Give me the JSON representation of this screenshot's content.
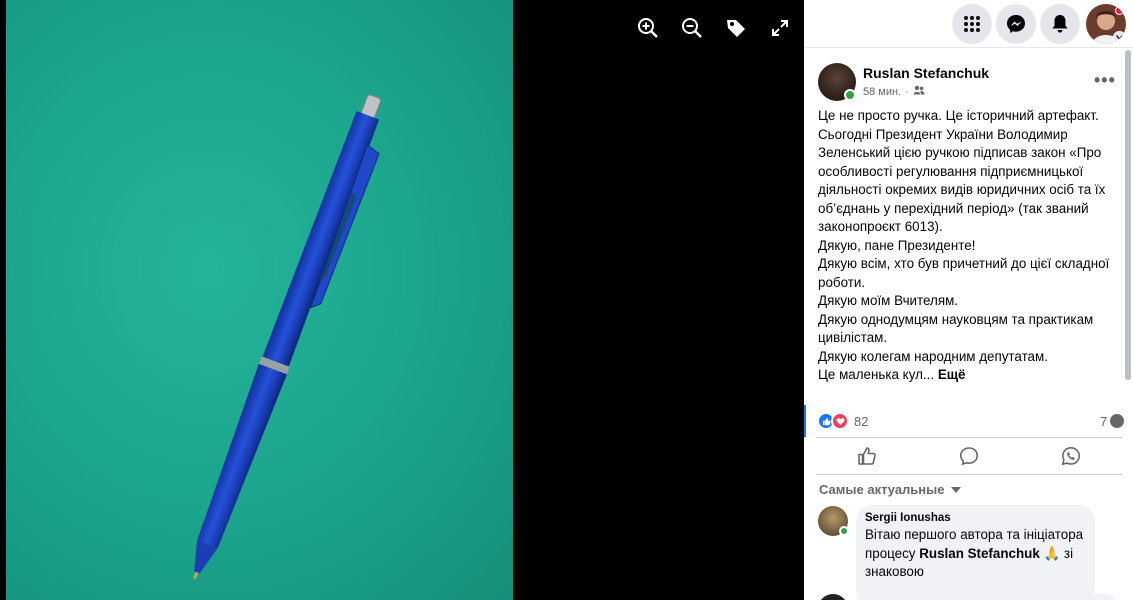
{
  "viewer": {
    "tools": [
      {
        "icon": "zoom-in-icon"
      },
      {
        "icon": "zoom-out-icon"
      },
      {
        "icon": "tag-icon"
      },
      {
        "icon": "fullscreen-icon"
      }
    ]
  },
  "topbar": {
    "buttons": [
      {
        "icon": "menu-grid-icon"
      },
      {
        "icon": "messenger-icon"
      },
      {
        "icon": "notifications-bell-icon"
      }
    ],
    "profile": {
      "icon": "profile-avatar",
      "has_notification": true
    }
  },
  "post": {
    "author": "Ruslan Stefanchuk",
    "time": "58 мин.",
    "separator": "·",
    "audience_icon": "friends-icon",
    "lines": [
      "Це не просто ручка. Це історичний артефакт.",
      "Сьогодні Президент України Володимир",
      "Зеленський цією ручкою підписав закон «Про",
      "особливості регулювання підприємницької",
      "діяльності окремих видів юридичних осіб та їх",
      "об’єднань у перехідний період» (так званий",
      "законопроєкт 6013).",
      "Дякую, пане Президенте!",
      "Дякую всім, хто був причетний до цієї складної",
      "роботи.",
      "Дякую моїм Вчителям.",
      "Дякую однодумцям науковцям та практикам",
      "цивілістам.",
      "Дякую колегам народним депутатам."
    ],
    "last_line": "Це маленька кул...",
    "see_more": "Ещё",
    "reactions_count": "82",
    "comments_count": "7"
  },
  "comments": {
    "sort_label": "Самые актуальные",
    "items": [
      {
        "author": "Sergii Ionushas",
        "text_before": "Вітаю першого автора та ініціатора процесу ",
        "mention": "Ruslan Stefanchuk",
        "emoji": "🙏",
        "text_after": " зі знаковою"
      }
    ]
  }
}
